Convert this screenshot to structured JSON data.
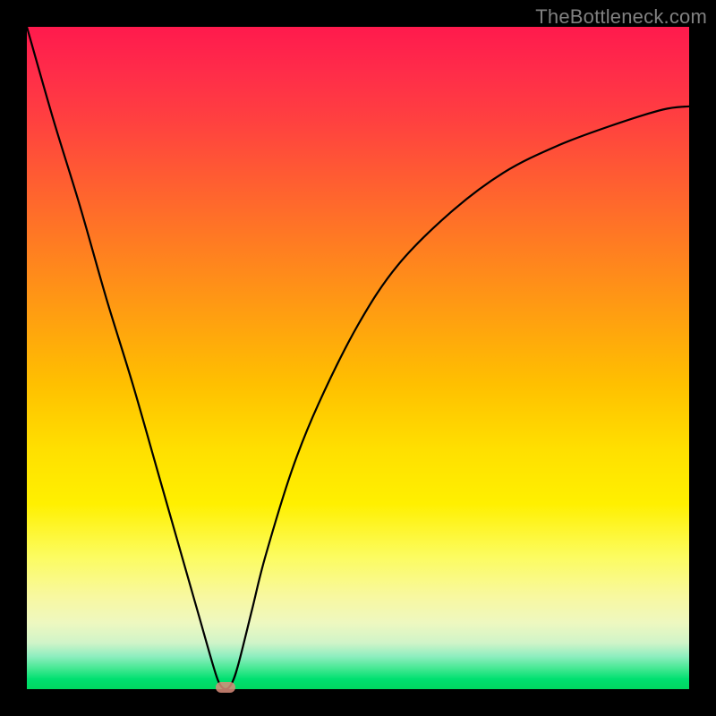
{
  "watermark": "TheBottleneck.com",
  "colors": {
    "frame": "#000000",
    "curve": "#000000",
    "marker": "#d98c7a",
    "watermark": "#808080"
  },
  "chart_data": {
    "type": "line",
    "title": "",
    "xlabel": "",
    "ylabel": "",
    "xlim": [
      0,
      100
    ],
    "ylim": [
      0,
      100
    ],
    "grid": false,
    "legend": false,
    "series": [
      {
        "name": "bottleneck-curve",
        "x": [
          0,
          4,
          8,
          12,
          16,
          20,
          24,
          26,
          28,
          29,
          30,
          31,
          32,
          34,
          36,
          40,
          44,
          50,
          56,
          64,
          72,
          80,
          88,
          96,
          100
        ],
        "y": [
          100,
          86,
          73,
          59,
          46,
          32,
          18,
          11,
          4,
          1,
          0,
          1,
          4,
          12,
          20,
          33,
          43,
          55,
          64,
          72,
          78,
          82,
          85,
          87.5,
          88
        ]
      }
    ],
    "annotations": [
      {
        "type": "marker",
        "x": 30,
        "y": 0,
        "label": "optimal-point"
      }
    ]
  }
}
